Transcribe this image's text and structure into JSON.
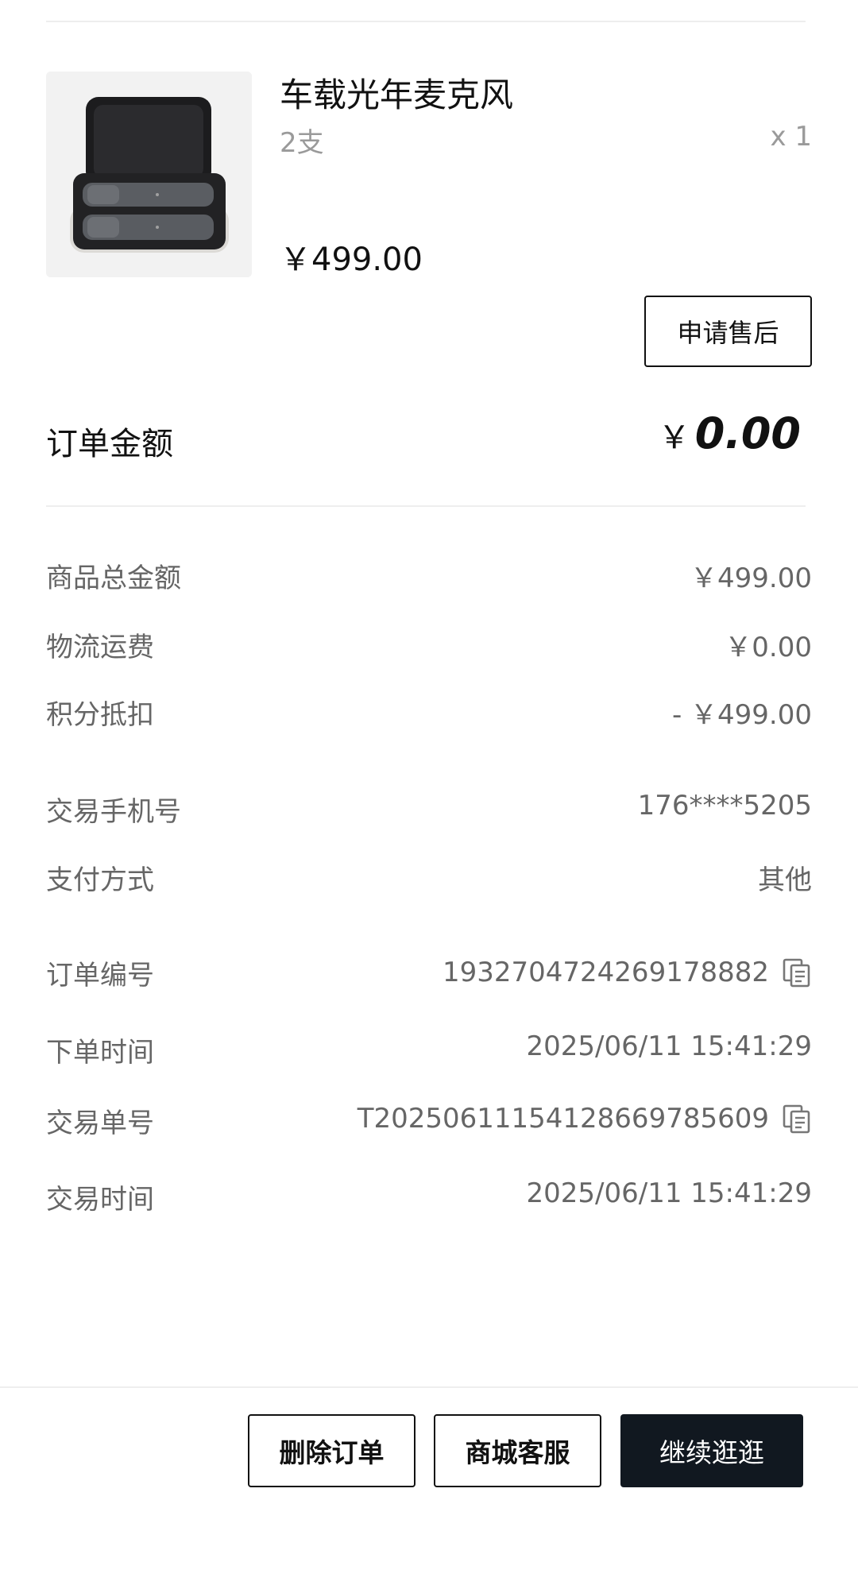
{
  "product": {
    "name": "车载光年麦克风",
    "spec": "2支",
    "quantity": "x 1",
    "price": "￥499.00",
    "after_sale_label": "申请售后"
  },
  "order_amount": {
    "label": "订单金额",
    "currency": "￥",
    "value": "0.00"
  },
  "details": {
    "goods_total": {
      "label": "商品总金额",
      "value": "￥499.00"
    },
    "shipping": {
      "label": "物流运费",
      "value": "￥0.00"
    },
    "points_deduction": {
      "label": "积分抵扣",
      "value": "- ￥499.00"
    },
    "phone": {
      "label": "交易手机号",
      "value": "176****5205"
    },
    "payment_method": {
      "label": "支付方式",
      "value": "其他"
    },
    "order_no": {
      "label": "订单编号",
      "value": "1932704724269178882"
    },
    "order_time": {
      "label": "下单时间",
      "value": "2025/06/11 15:41:29"
    },
    "trade_no": {
      "label": "交易单号",
      "value": "T20250611154128669785609"
    },
    "trade_time": {
      "label": "交易时间",
      "value": "2025/06/11 15:41:29"
    }
  },
  "bottom_bar": {
    "delete_label": "删除订单",
    "service_label": "商城客服",
    "continue_label": "继续逛逛"
  },
  "colors": {
    "accent_dark": "#111820",
    "secondary_text": "#666666",
    "muted_text": "#9a9a9a"
  }
}
